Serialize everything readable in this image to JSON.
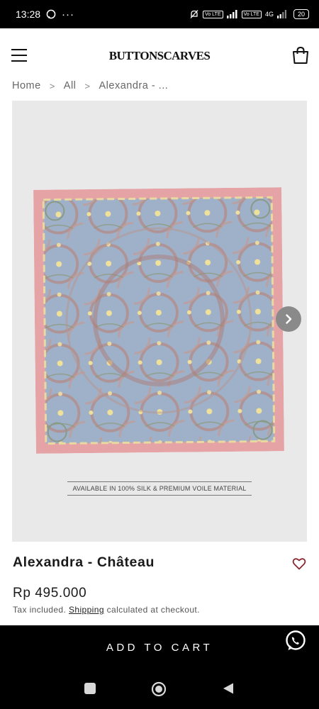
{
  "status_bar": {
    "time": "13:28",
    "more": "···",
    "volte_1": "Vo LTE",
    "volte_2": "Vo LTE",
    "network": "4G",
    "battery": "20"
  },
  "header": {
    "logo": "BUTTONSCARVES"
  },
  "breadcrumb": {
    "items": [
      "Home",
      "All",
      "Alexandra - ..."
    ],
    "separator": ">"
  },
  "product": {
    "image_caption": "AVAILABLE IN 100% SILK & PREMIUM VOILE MATERIAL",
    "title": "Alexandra - Château",
    "price": "Rp 495.000",
    "tax_prefix": "Tax included.",
    "shipping_link": "Shipping",
    "tax_suffix": "calculated at checkout."
  },
  "cart": {
    "label": "ADD TO CART"
  },
  "icons": {
    "menu": "menu-icon",
    "cart": "shopping-bag-icon",
    "next": "chevron-right-icon",
    "wishlist": "heart-icon",
    "chat": "whatsapp-icon"
  },
  "colors": {
    "scarf_border": "#e5a3a6",
    "scarf_field": "#9fb1c9",
    "accent": "#000000",
    "heart": "#8a2730"
  }
}
